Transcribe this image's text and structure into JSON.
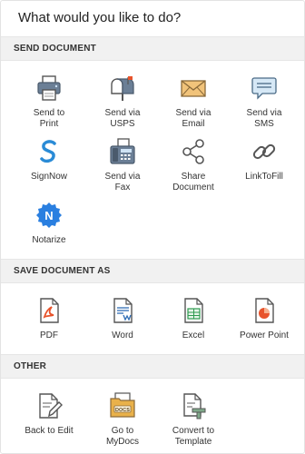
{
  "title": "What would you like to do?",
  "sections": {
    "send": {
      "header": "SEND DOCUMENT",
      "items": [
        {
          "label": "Send to\nPrint",
          "icon": "printer-icon"
        },
        {
          "label": "Send via\nUSPS",
          "icon": "mailbox-icon"
        },
        {
          "label": "Send via\nEmail",
          "icon": "envelope-icon"
        },
        {
          "label": "Send via\nSMS",
          "icon": "chat-bubble-icon"
        },
        {
          "label": "SignNow",
          "icon": "signnow-logo-icon"
        },
        {
          "label": "Send via\nFax",
          "icon": "fax-icon"
        },
        {
          "label": "Share\nDocument",
          "icon": "share-icon"
        },
        {
          "label": "LinkToFill",
          "icon": "link-icon"
        },
        {
          "label": "Notarize",
          "icon": "notarize-icon"
        }
      ]
    },
    "save": {
      "header": "SAVE DOCUMENT AS",
      "items": [
        {
          "label": "PDF",
          "icon": "pdf-file-icon"
        },
        {
          "label": "Word",
          "icon": "word-file-icon"
        },
        {
          "label": "Excel",
          "icon": "excel-file-icon"
        },
        {
          "label": "Power Point",
          "icon": "powerpoint-file-icon"
        }
      ]
    },
    "other": {
      "header": "OTHER",
      "items": [
        {
          "label": "Back to Edit",
          "icon": "edit-document-icon"
        },
        {
          "label": "Go to\nMyDocs",
          "icon": "docs-folder-icon"
        },
        {
          "label": "Convert to\nTemplate",
          "icon": "template-icon"
        }
      ]
    }
  },
  "icon_text": {
    "docs": "DOCS"
  },
  "colors": {
    "blue": "#2a8bd6",
    "header_bg": "#f1f1f1",
    "pdf": "#e8532b",
    "word": "#2f6db5",
    "excel": "#2e9a4f",
    "powerpoint": "#e8532b",
    "envelope": "#f1c37a",
    "bubble": "#9fc6e6"
  }
}
